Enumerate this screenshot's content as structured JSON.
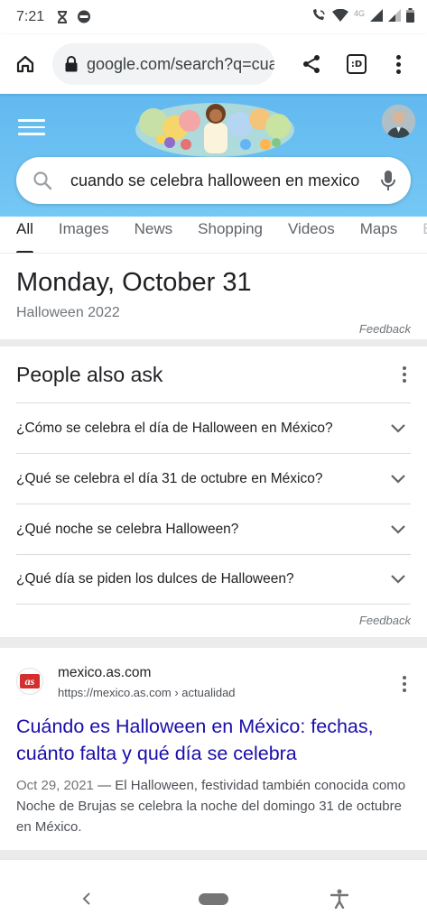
{
  "status_bar": {
    "time": "7:21",
    "icons_left": [
      "hourglass-icon",
      "chat-bubble-icon"
    ],
    "icons_right": [
      "wifi-calling-icon",
      "wifi-icon",
      "signal-4g-icon",
      "signal-icon",
      "battery-icon"
    ],
    "network_label": "4G"
  },
  "browser": {
    "url": "google.com/search?q=cuando+se+celebra",
    "tabs_count_label": ":D"
  },
  "google": {
    "doodle_alt": "Google Doodle",
    "search_query": "cuando se celebra halloween en mexico"
  },
  "tabs": [
    {
      "label": "All",
      "active": true
    },
    {
      "label": "Images"
    },
    {
      "label": "News"
    },
    {
      "label": "Shopping"
    },
    {
      "label": "Videos"
    },
    {
      "label": "Maps"
    },
    {
      "label": "B"
    }
  ],
  "date_card": {
    "title": "Monday, October 31",
    "subtitle": "Halloween 2022",
    "feedback": "Feedback"
  },
  "paa": {
    "title": "People also ask",
    "questions": [
      "¿Cómo se celebra el día de Halloween en México?",
      "¿Qué se celebra el día 31 de octubre en México?",
      "¿Qué noche se celebra Halloween?",
      "¿Qué día se piden los dulces de Halloween?"
    ],
    "feedback": "Feedback"
  },
  "result": {
    "favicon_text": "as",
    "site_name": "mexico.as.com",
    "breadcrumb": "https://mexico.as.com › actualidad",
    "title": "Cuándo es Halloween en México: fechas, cuánto falta y qué día se celebra",
    "date": "Oct 29, 2021",
    "snippet": " — El Halloween, festividad también conocida como Noche de Brujas se celebra la noche del domingo 31 de octubre en México."
  },
  "colors": {
    "header_bg": "#62b9f0",
    "link": "#1a0dab",
    "favicon": "#d32f2f"
  }
}
